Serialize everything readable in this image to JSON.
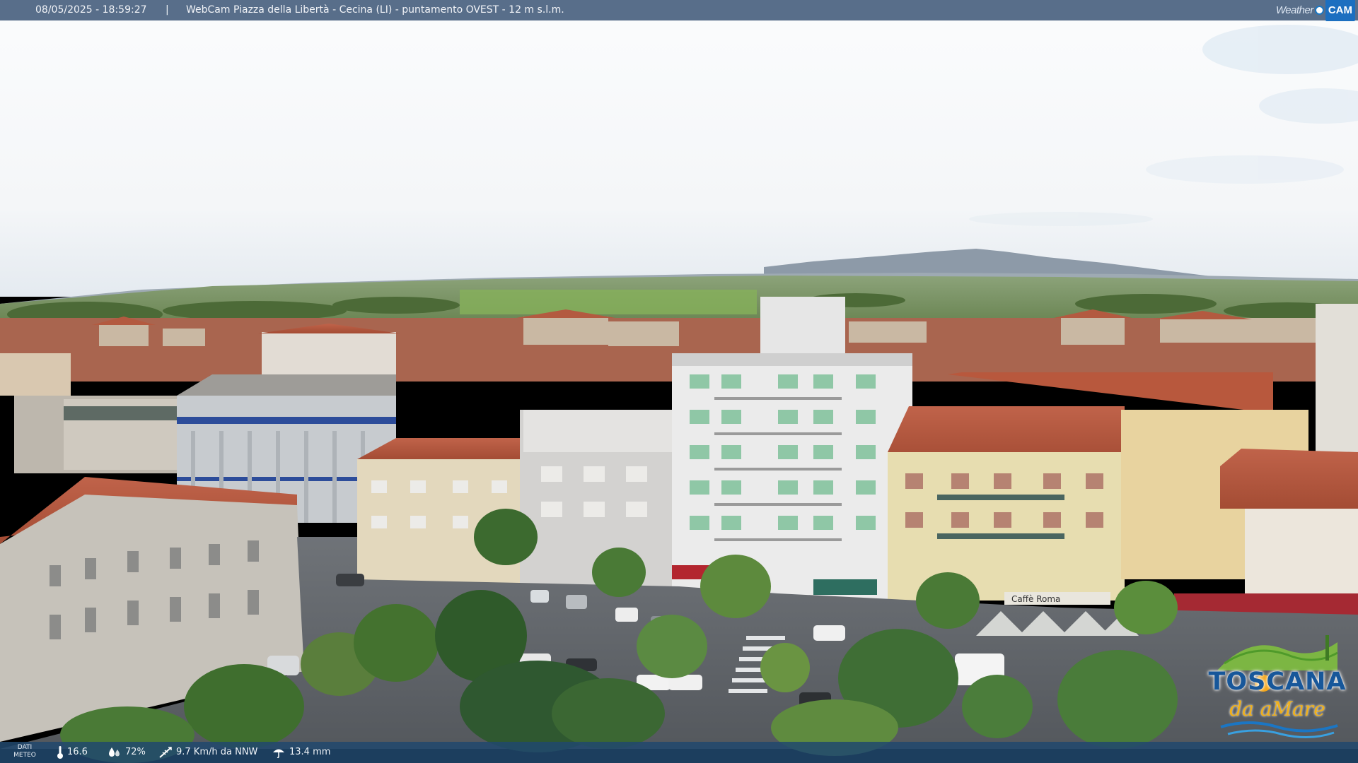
{
  "header": {
    "timestamp": "08/05/2025 - 18:59:27",
    "separator": "|",
    "title": "WebCam Piazza della Libertà - Cecina (LI) - puntamento OVEST - 12 m s.l.m.",
    "logo_word": "Weather",
    "logo_cam": "CAM"
  },
  "meteo": {
    "label_line1": "DATI",
    "label_line2": "METEO",
    "temperature": "16.6",
    "humidity": "72%",
    "wind": "9.7 Km/h da NNW",
    "rain": "13.4 mm"
  },
  "toscana_logo": {
    "brand": "TOSCANA",
    "sub": "da aMare"
  },
  "storefront": {
    "sign": "Caffè Roma"
  },
  "colors": {
    "top_bar": "#4a6280",
    "meteo_bar": "#21486e",
    "roof": "#b5553a",
    "brand_blue": "#17579a",
    "brand_yellow": "#f0b01a"
  }
}
